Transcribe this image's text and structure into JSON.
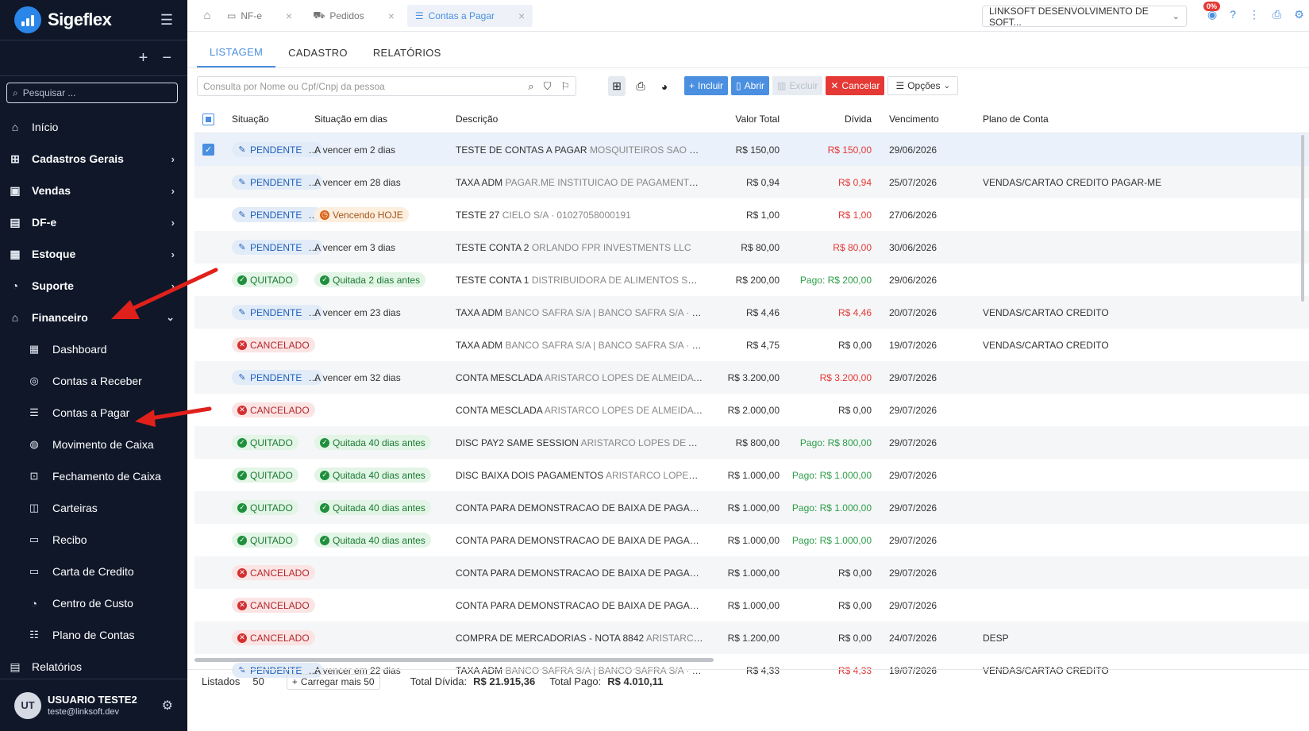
{
  "app": {
    "name": "Sigeflex"
  },
  "sidebar": {
    "search_placeholder": "Pesquisar ...",
    "items": [
      {
        "label": "Início"
      },
      {
        "label": "Cadastros Gerais"
      },
      {
        "label": "Vendas"
      },
      {
        "label": "DF-e"
      },
      {
        "label": "Estoque"
      },
      {
        "label": "Suporte"
      },
      {
        "label": "Financeiro"
      }
    ],
    "financeiro_sub": [
      {
        "label": "Dashboard"
      },
      {
        "label": "Contas a Receber"
      },
      {
        "label": "Contas a Pagar"
      },
      {
        "label": "Movimento de Caixa"
      },
      {
        "label": "Fechamento de Caixa"
      },
      {
        "label": "Carteiras"
      },
      {
        "label": "Recibo"
      },
      {
        "label": "Carta de Credito"
      },
      {
        "label": "Centro de Custo"
      },
      {
        "label": "Plano de Contas"
      }
    ],
    "relatorios": "Relatórios",
    "user": {
      "initials": "UT",
      "name": "USUARIO TESTE2",
      "email": "teste@linksoft.dev"
    }
  },
  "tabs": [
    {
      "label": "NF-e"
    },
    {
      "label": "Pedidos"
    },
    {
      "label": "Contas a Pagar"
    }
  ],
  "company": "LINKSOFT DESENVOLVIMENTO DE SOFT...",
  "notif_badge": "0%",
  "section_tabs": [
    "LISTAGEM",
    "CADASTRO",
    "RELATÓRIOS"
  ],
  "toolbar": {
    "search_placeholder": "Consulta por Nome ou Cpf/Cnpj da pessoa",
    "incluir": "Incluir",
    "abrir": "Abrir",
    "excluir": "Excluir",
    "cancelar": "Cancelar",
    "opcoes": "Opções"
  },
  "table": {
    "headers": {
      "situacao": "Situação",
      "dias": "Situação em dias",
      "descricao": "Descrição",
      "valor": "Valor Total",
      "divida": "Dívida",
      "vencimento": "Vencimento",
      "plano": "Plano de Conta"
    },
    "rows": [
      {
        "status": "PENDENTE",
        "dias": "A vencer em 2 dias",
        "desc": "TESTE DE CONTAS A PAGAR",
        "desc_muted": "MOSQUITEIROS SAO JOSE LT...",
        "valor": "R$ 150,00",
        "divida": "R$ 150,00",
        "venc": "29/06/2026",
        "plano": ""
      },
      {
        "status": "PENDENTE",
        "dias": "A vencer em 28 dias",
        "desc": "TAXA ADM",
        "desc_muted": "PAGAR.ME INSTITUICAO DE PAGAMENTO S.A |...",
        "valor": "R$ 0,94",
        "divida": "R$ 0,94",
        "venc": "25/07/2026",
        "plano": "VENDAS/CARTAO CREDITO PAGAR-ME"
      },
      {
        "status": "PENDENTE",
        "dias": "Vencendo HOJE",
        "desc": "TESTE 27",
        "desc_muted": "CIELO S/A · 01027058000191",
        "valor": "R$ 1,00",
        "divida": "R$ 1,00",
        "venc": "27/06/2026",
        "plano": ""
      },
      {
        "status": "PENDENTE",
        "dias": "A vencer em 3 dias",
        "desc": "TESTE CONTA 2",
        "desc_muted": "ORLANDO FPR INVESTMENTS LLC",
        "valor": "R$ 80,00",
        "divida": "R$ 80,00",
        "venc": "30/06/2026",
        "plano": ""
      },
      {
        "status": "QUITADO",
        "dias": "Quitada 2 dias antes",
        "desc": "TESTE CONTA 1",
        "desc_muted": "DISTRIBUIDORA DE ALIMENTOS SERIDO L...",
        "valor": "R$ 200,00",
        "divida": "Pago: R$ 200,00",
        "venc": "29/06/2026",
        "plano": ""
      },
      {
        "status": "PENDENTE",
        "dias": "A vencer em 23 dias",
        "desc": "TAXA ADM",
        "desc_muted": "BANCO SAFRA S/A | BANCO SAFRA S/A · 5816...",
        "valor": "R$ 4,46",
        "divida": "R$ 4,46",
        "venc": "20/07/2026",
        "plano": "VENDAS/CARTAO CREDITO"
      },
      {
        "status": "CANCELADO",
        "dias": "",
        "desc": "TAXA ADM",
        "desc_muted": "BANCO SAFRA S/A | BANCO SAFRA S/A · 5816...",
        "valor": "R$ 4,75",
        "divida": "R$ 0,00",
        "venc": "19/07/2026",
        "plano": "VENDAS/CARTAO CREDITO"
      },
      {
        "status": "PENDENTE",
        "dias": "A vencer em 32 dias",
        "desc": "CONTA MESCLADA",
        "desc_muted": "ARISTARCO LOPES DE ALMEIDA · 0923...",
        "valor": "R$ 3.200,00",
        "divida": "R$ 3.200,00",
        "venc": "29/07/2026",
        "plano": ""
      },
      {
        "status": "CANCELADO",
        "dias": "",
        "desc": "CONTA MESCLADA",
        "desc_muted": "ARISTARCO LOPES DE ALMEIDA · 0923...",
        "valor": "R$ 2.000,00",
        "divida": "R$ 0,00",
        "venc": "29/07/2026",
        "plano": ""
      },
      {
        "status": "QUITADO",
        "dias": "Quitada 40 dias antes",
        "desc": "DISC PAY2 SAME SESSION",
        "desc_muted": "ARISTARCO LOPES DE ALMEID...",
        "valor": "R$ 800,00",
        "divida": "Pago: R$ 800,00",
        "venc": "29/07/2026",
        "plano": ""
      },
      {
        "status": "QUITADO",
        "dias": "Quitada 40 dias antes",
        "desc": "DISC BAIXA DOIS PAGAMENTOS",
        "desc_muted": "ARISTARCO LOPES DE AL...",
        "valor": "R$ 1.000,00",
        "divida": "Pago: R$ 1.000,00",
        "venc": "29/07/2026",
        "plano": ""
      },
      {
        "status": "QUITADO",
        "dias": "Quitada 40 dias antes",
        "desc": "CONTA PARA DEMONSTRACAO DE BAIXA DE PAGAMENT...",
        "desc_muted": "",
        "valor": "R$ 1.000,00",
        "divida": "Pago: R$ 1.000,00",
        "venc": "29/07/2026",
        "plano": ""
      },
      {
        "status": "QUITADO",
        "dias": "Quitada 40 dias antes",
        "desc": "CONTA PARA DEMONSTRACAO DE BAIXA DE PAGAMENT...",
        "desc_muted": "",
        "valor": "R$ 1.000,00",
        "divida": "Pago: R$ 1.000,00",
        "venc": "29/07/2026",
        "plano": ""
      },
      {
        "status": "CANCELADO",
        "dias": "",
        "desc": "CONTA PARA DEMONSTRACAO DE BAIXA DE PAGAMENT...",
        "desc_muted": "",
        "valor": "R$ 1.000,00",
        "divida": "R$ 0,00",
        "venc": "29/07/2026",
        "plano": ""
      },
      {
        "status": "CANCELADO",
        "dias": "",
        "desc": "CONTA PARA DEMONSTRACAO DE BAIXA DE PAGAMENT...",
        "desc_muted": "",
        "valor": "R$ 1.000,00",
        "divida": "R$ 0,00",
        "venc": "29/07/2026",
        "plano": ""
      },
      {
        "status": "CANCELADO",
        "dias": "",
        "desc": "COMPRA DE MERCADORIAS - NOTA 8842",
        "desc_muted": "ARISTARCO LO...",
        "valor": "R$ 1.200,00",
        "divida": "R$ 0,00",
        "venc": "24/07/2026",
        "plano": "DESP"
      },
      {
        "status": "PENDENTE",
        "dias": "A vencer em 22 dias",
        "desc": "TAXA ADM",
        "desc_muted": "BANCO SAFRA S/A | BANCO SAFRA S/A · 5816...",
        "valor": "R$ 4,33",
        "divida": "R$ 4,33",
        "venc": "19/07/2026",
        "plano": "VENDAS/CARTAO CREDITO"
      }
    ]
  },
  "footer": {
    "listados_label": "Listados",
    "listados_value": "50",
    "carregar": "Carregar mais 50",
    "total_divida_label": "Total Dívida:",
    "total_divida": "R$ 21.915,36",
    "total_pago_label": "Total Pago:",
    "total_pago": "R$ 4.010,11"
  },
  "colors": {
    "sidebar": "#0f1729",
    "accent": "#4a8fe0",
    "danger": "#e53935",
    "success": "#2e9e49"
  }
}
